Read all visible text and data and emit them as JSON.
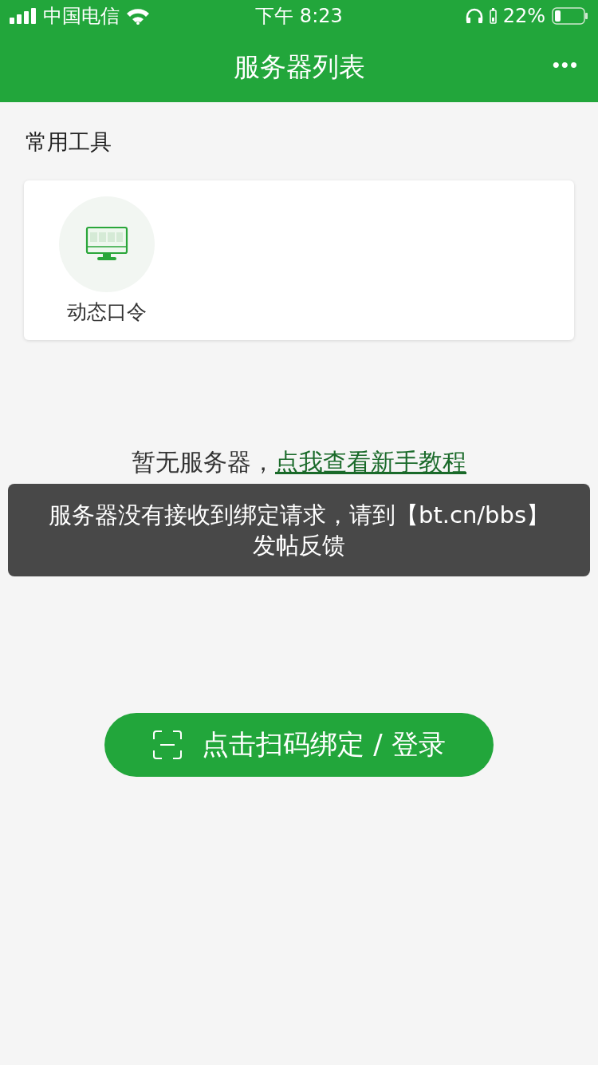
{
  "status_bar": {
    "carrier": "中国电信",
    "time": "下午 8:23",
    "battery": "22%"
  },
  "nav": {
    "title": "服务器列表",
    "more": "•••"
  },
  "section": {
    "title": "常用工具"
  },
  "tools": [
    {
      "label": "动态口令"
    }
  ],
  "empty_state": {
    "text": "暂无服务器，",
    "link": "点我查看新手教程"
  },
  "toast": {
    "message": "服务器没有接收到绑定请求，请到【bt.cn/bbs】发帖反馈"
  },
  "scan_button": {
    "label": "点击扫码绑定 / 登录"
  }
}
